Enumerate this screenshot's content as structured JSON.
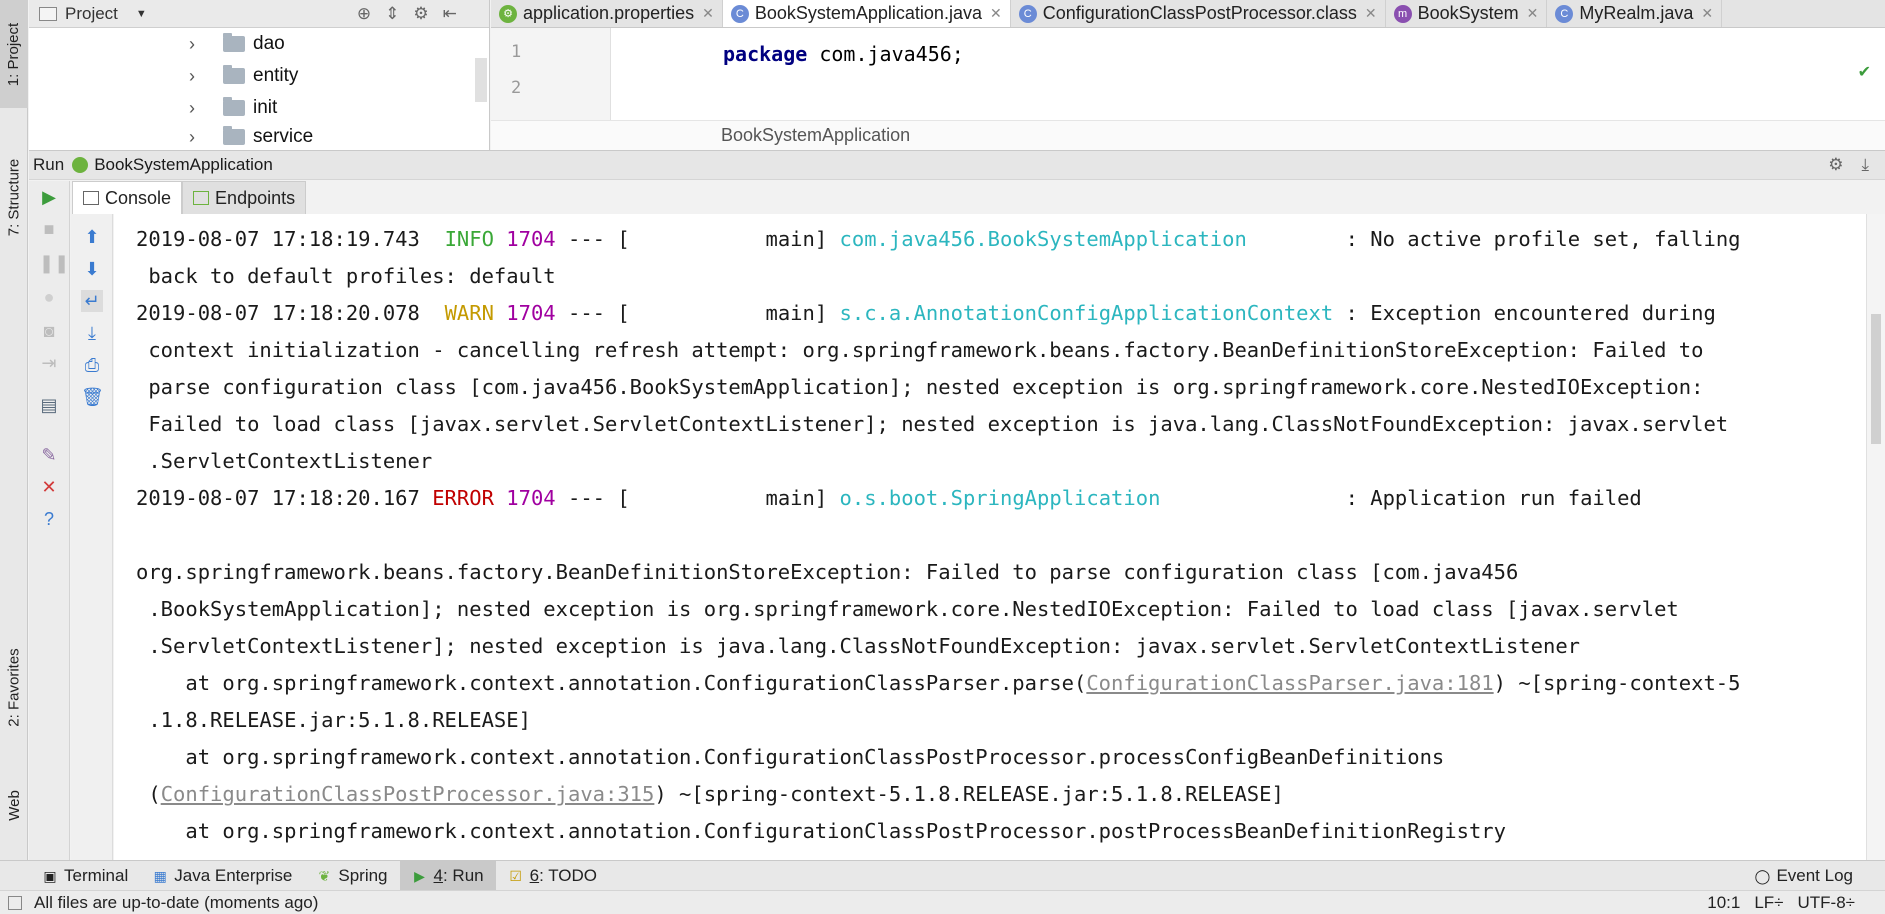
{
  "left_stripe": {
    "project": "1: Project",
    "structure": "7: Structure",
    "favorites": "2: Favorites",
    "web": "Web"
  },
  "project_panel": {
    "title": "Project",
    "items": [
      {
        "label": "dao"
      },
      {
        "label": "entity"
      },
      {
        "label": "init"
      },
      {
        "label": "service"
      }
    ]
  },
  "editor": {
    "tabs": [
      {
        "label": "application.properties",
        "icon_color": "#6db33f",
        "icon": "spring-properties-icon"
      },
      {
        "label": "BookSystemApplication.java",
        "icon_color": "#6b8bd6",
        "icon": "java-class-icon",
        "active": true
      },
      {
        "label": "ConfigurationClassPostProcessor.class",
        "icon_color": "#6b8bd6",
        "icon": "class-file-icon"
      },
      {
        "label": "BookSystem",
        "icon_color": "#8a4fb0",
        "icon": "maven-icon"
      },
      {
        "label": "MyRealm.java",
        "icon_color": "#6b8bd6",
        "icon": "java-class-icon"
      }
    ],
    "lines": [
      "1",
      "2"
    ],
    "code_keyword": "package",
    "code_rest": " com.java456;",
    "breadcrumb": "BookSystemApplication"
  },
  "run": {
    "label": "Run",
    "config": "BookSystemApplication",
    "tabs": {
      "console": "Console",
      "endpoints": "Endpoints"
    }
  },
  "console": {
    "l1": {
      "ts": "2019-08-07 17:18:19.743  ",
      "level": "INFO",
      "pid": " 1704",
      "mid": " --- [           main] ",
      "cls": "com.java456.BookSystemApplication",
      "msg": "        : No active profile set, falling"
    },
    "l2": " back to default profiles: default",
    "l3": {
      "ts": "2019-08-07 17:18:20.078  ",
      "level": "WARN",
      "pid": " 1704",
      "mid": " --- [           main] ",
      "cls": "s.c.a.AnnotationConfigApplicationContext",
      "msg": " : Exception encountered during"
    },
    "l4": " context initialization - cancelling refresh attempt: org.springframework.beans.factory.BeanDefinitionStoreException: Failed to",
    "l5": " parse configuration class [com.java456.BookSystemApplication]; nested exception is org.springframework.core.NestedIOException:",
    "l6": " Failed to load class [javax.servlet.ServletContextListener]; nested exception is java.lang.ClassNotFoundException: javax.servlet",
    "l7": " .ServletContextListener",
    "l8": {
      "ts": "2019-08-07 17:18:20.167 ",
      "level": "ERROR",
      "pid": " 1704",
      "mid": " --- [           main] ",
      "cls": "o.s.boot.SpringApplication",
      "msg": "               : Application run failed"
    },
    "l10": "org.springframework.beans.factory.BeanDefinitionStoreException: Failed to parse configuration class [com.java456",
    "l11": " .BookSystemApplication]; nested exception is org.springframework.core.NestedIOException: Failed to load class [javax.servlet",
    "l12": " .ServletContextListener]; nested exception is java.lang.ClassNotFoundException: javax.servlet.ServletContextListener",
    "l13": {
      "pre": "    at org.springframework.context.annotation.ConfigurationClassParser.parse(",
      "link": "ConfigurationClassParser.java:181",
      "post": ") ~[spring-context-5"
    },
    "l14": " .1.8.RELEASE.jar:5.1.8.RELEASE]",
    "l15": "    at org.springframework.context.annotation.ConfigurationClassPostProcessor.processConfigBeanDefinitions",
    "l16": {
      "pre": " (",
      "link": "ConfigurationClassPostProcessor.java:315",
      "post": ") ~[spring-context-5.1.8.RELEASE.jar:5.1.8.RELEASE]"
    },
    "l17": "    at org.springframework.context.annotation.ConfigurationClassPostProcessor.postProcessBeanDefinitionRegistry"
  },
  "bottom_bar": {
    "terminal": "Terminal",
    "java_enterprise": "Java Enterprise",
    "spring": "Spring",
    "run_num": "4",
    "run_label": ": Run",
    "todo_num": "6",
    "todo_label": ": TODO",
    "event_log": "Event Log"
  },
  "status_bar": {
    "message": "All files are up-to-date (moments ago)",
    "position": "10:1",
    "line_sep": "LF÷",
    "encoding": "UTF-8÷"
  },
  "colors": {
    "info": "#3aa837",
    "warn": "#c49a00",
    "error": "#c00000",
    "class_name": "#2cb6bf"
  }
}
